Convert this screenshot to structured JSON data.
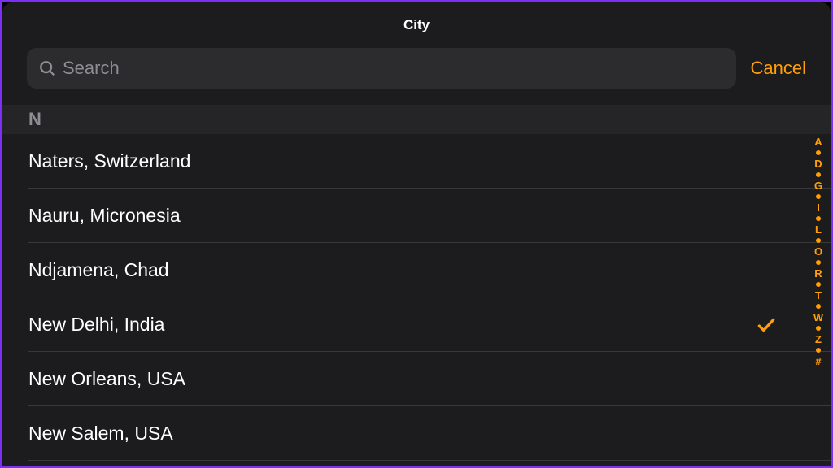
{
  "header": {
    "title": "City"
  },
  "search": {
    "placeholder": "Search",
    "cancel_label": "Cancel"
  },
  "section": {
    "letter": "N"
  },
  "cities": [
    {
      "name": "Naters, Switzerland",
      "selected": false
    },
    {
      "name": "Nauru, Micronesia",
      "selected": false
    },
    {
      "name": "Ndjamena, Chad",
      "selected": false
    },
    {
      "name": "New Delhi, India",
      "selected": true
    },
    {
      "name": "New Orleans, USA",
      "selected": false
    },
    {
      "name": "New Salem, USA",
      "selected": false
    }
  ],
  "index_bar": [
    "A",
    "•",
    "D",
    "•",
    "G",
    "•",
    "I",
    "•",
    "L",
    "•",
    "O",
    "•",
    "R",
    "•",
    "T",
    "•",
    "W",
    "•",
    "Z",
    "•",
    "#"
  ],
  "colors": {
    "accent": "#ff9f0a",
    "background": "#1c1c1e",
    "search_bg": "#2c2c2e",
    "text": "#ffffff",
    "secondary": "#8e8e93"
  }
}
